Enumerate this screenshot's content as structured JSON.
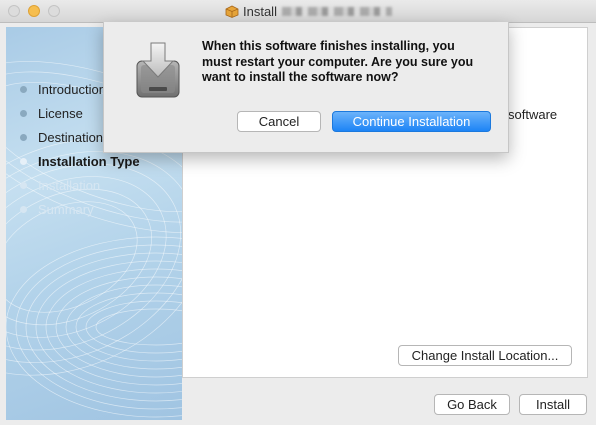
{
  "window": {
    "title_prefix": "Install",
    "title_redacted": true
  },
  "sidebar": {
    "steps": [
      {
        "label": "Introduction",
        "state": "done"
      },
      {
        "label": "License",
        "state": "done"
      },
      {
        "label": "Destination Select",
        "state": "done"
      },
      {
        "label": "Installation Type",
        "state": "active"
      },
      {
        "label": "Installation",
        "state": "pending"
      },
      {
        "label": "Summary",
        "state": "pending"
      }
    ]
  },
  "main": {
    "partial_text": "software",
    "change_location_label": "Change Install Location..."
  },
  "footer": {
    "go_back_label": "Go Back",
    "install_label": "Install"
  },
  "dialog": {
    "message": "When this software finishes installing, you must restart your computer. Are you sure you want to install the software now?",
    "cancel_label": "Cancel",
    "continue_label": "Continue Installation",
    "icon": "package-installer-icon"
  },
  "colors": {
    "accent": "#1d84f6",
    "sidebar_background": "#b3d3ea"
  }
}
